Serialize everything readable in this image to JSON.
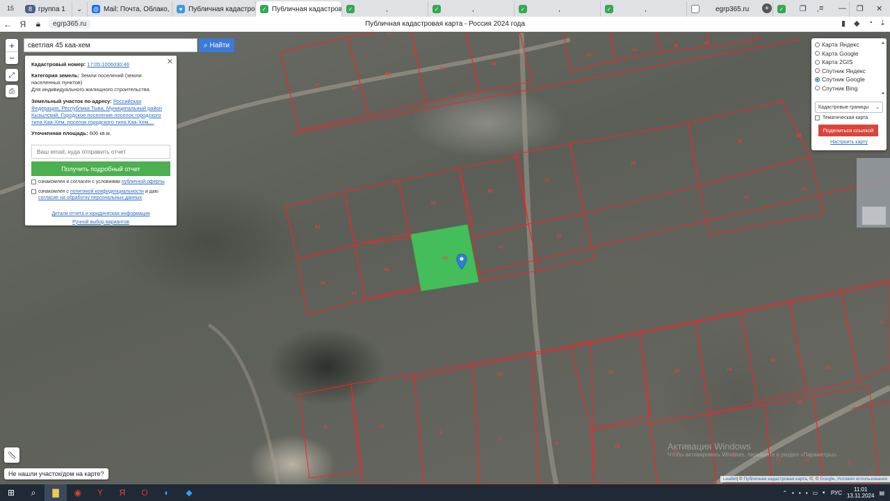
{
  "browser": {
    "tab_count": "15",
    "tabs": [
      {
        "label": "группа 1",
        "group": "8"
      },
      {
        "label": "Mail: Почта, Облако, Кале"
      },
      {
        "label": "Публичная кадастровая"
      },
      {
        "label": "Публичная кадастров",
        "active": true
      },
      {
        "label": ","
      },
      {
        "label": ","
      },
      {
        "label": ","
      },
      {
        "label": ","
      },
      {
        "label": "egrp365.ru"
      },
      {
        "label": ","
      }
    ],
    "url": "egrp365.ru",
    "page_title": "Публичная кадастровая карта - Россия 2024 года"
  },
  "search": {
    "value": "светлая 45 каа-хем",
    "button_label": "Найти"
  },
  "info": {
    "cadastral_label": "Кадастровый номер:",
    "cadastral_number": "17:05:1006030:46",
    "category_label": "Категория земель:",
    "category_value": "Земли поселений (земли населенных пунктов)",
    "usage": "Для индивидуального жилищного строительства",
    "address_label": "Земельный участок по адресу:",
    "address_value": "Российская Федерация, Республика Тыва, Муниципальный район Кызылский, Городское поселение поселок городского типа Каа-Хем, поселок городского типа Каа-Хем,...",
    "area_label": "Уточненная площадь:",
    "area_value": "606 кв.м.",
    "email_placeholder": "Ваш email, куда отправить отчет",
    "report_button": "Получить подробный отчет",
    "consent1_text": "ознакомлен и согласен с условиями",
    "consent1_link": "публичной оферты",
    "consent2_text": "ознакомлен с",
    "consent2_link": "политикой конфиденциальности",
    "consent2_mid": "и даю",
    "consent2_link2": "согласие на обработку персональных данных",
    "details_link": "Детали отчета и юридическая информация",
    "manual_link": "Ручной выбор вариантов"
  },
  "layers": {
    "options": [
      {
        "label": "Карта Яндекс",
        "selected": false
      },
      {
        "label": "Карта Google",
        "selected": false
      },
      {
        "label": "Карта 2GIS",
        "selected": false
      },
      {
        "label": "Спутник Яндекс",
        "selected": false
      },
      {
        "label": "Спутник Google",
        "selected": true
      },
      {
        "label": "Спутник Bing",
        "selected": false
      }
    ],
    "select_value": "Кадастровые границы",
    "thematic_label": "Тематическая карта",
    "share_button": "Поделиться ссылкой",
    "configure_link": "Настроить карту"
  },
  "map": {
    "selected_plot_number": "46",
    "plot_numbers": [
      "53",
      "54",
      "57",
      "57",
      "54",
      "50",
      "48",
      "51",
      "49",
      "39",
      "37",
      "58",
      "58",
      "35",
      "51",
      "45",
      "34",
      "42",
      "43",
      "42",
      "41",
      "33",
      "48",
      "44",
      "44",
      "27",
      "25",
      "11",
      "16",
      "14",
      "18",
      "26",
      "18",
      "6",
      "10",
      "9",
      "7",
      "8",
      "24",
      "20",
      "17",
      "12",
      "12",
      "5",
      "5"
    ],
    "not_found": "Не нашли участок/дом на карте?",
    "attribution_leaflet": "Leaflet",
    "attribution_text": "| © ",
    "attribution_pkk": "Публичная кадастровая карта",
    "attribution_mid": ", ©, © ",
    "attribution_google": "Google",
    "attribution_sep": ", ",
    "attribution_terms": "Условия использования",
    "watermark_title": "Активация Windows",
    "watermark_sub": "Чтобы активировать Windows, перейдите в раздел «Параметры»."
  },
  "taskbar": {
    "lang": "РУС",
    "time": "11:01",
    "date": "13.11.2024"
  },
  "colors": {
    "boundary": "#ff2020",
    "selected_fill": "#3fcf5a",
    "report_button": "#4caf50",
    "search_button": "#3c7bd6",
    "share_button": "#d9453b"
  }
}
